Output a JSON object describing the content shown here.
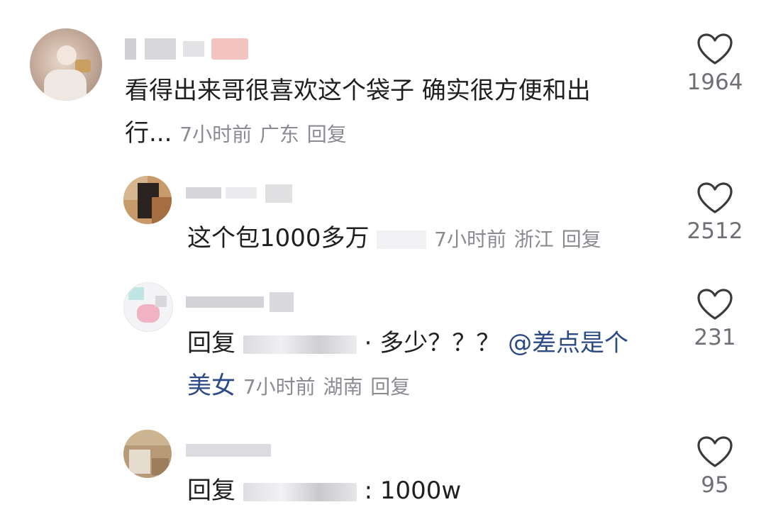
{
  "comments": [
    {
      "text": "看得出来哥很喜欢这个袋子 确实很方便和出",
      "text_cont": "行...",
      "time": "7小时前",
      "location": "广东",
      "reply": "回复",
      "likes": "1964"
    },
    {
      "text": "这个包1000多万",
      "time": "7小时前",
      "location": "浙江",
      "reply": "回复",
      "likes": "2512"
    },
    {
      "reply_prefix": "回复",
      "text": "· 多少？？？",
      "mention_a": "@差点是个",
      "mention_b": "美女",
      "time": "7小时前",
      "location": "湖南",
      "reply": "回复",
      "likes": "231"
    },
    {
      "reply_prefix": "回复",
      "text": ": 1000w",
      "likes": "95"
    }
  ],
  "colors": {
    "text": "#1f1f22",
    "meta": "#8b8b92",
    "mention": "#2b4a86",
    "heart": "#3a3a3f"
  },
  "icons": {
    "like": "heart-outline-icon"
  }
}
